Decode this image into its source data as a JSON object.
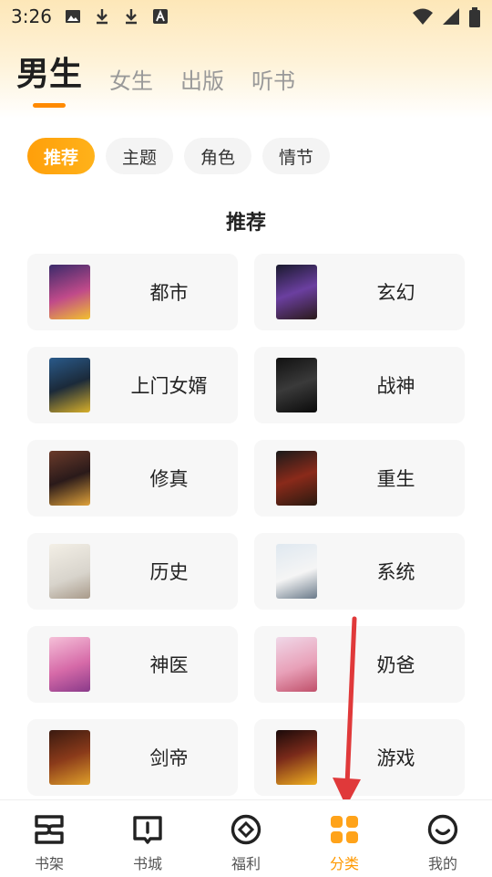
{
  "status": {
    "time": "3:26"
  },
  "tabs": [
    {
      "label": "男生"
    },
    {
      "label": "女生"
    },
    {
      "label": "出版"
    },
    {
      "label": "听书"
    }
  ],
  "chips": [
    {
      "label": "推荐"
    },
    {
      "label": "主题"
    },
    {
      "label": "角色"
    },
    {
      "label": "情节"
    }
  ],
  "section": {
    "title": "推荐"
  },
  "categories": [
    {
      "name": "都市"
    },
    {
      "name": "玄幻"
    },
    {
      "name": "上门女婿"
    },
    {
      "name": "战神"
    },
    {
      "name": "修真"
    },
    {
      "name": "重生"
    },
    {
      "name": "历史"
    },
    {
      "name": "系统"
    },
    {
      "name": "神医"
    },
    {
      "name": "奶爸"
    },
    {
      "name": "剑帝"
    },
    {
      "name": "游戏"
    }
  ],
  "nav": [
    {
      "label": "书架",
      "icon": "bookshelf-icon"
    },
    {
      "label": "书城",
      "icon": "book-icon"
    },
    {
      "label": "福利",
      "icon": "gift-icon"
    },
    {
      "label": "分类",
      "icon": "category-icon"
    },
    {
      "label": "我的",
      "icon": "profile-icon"
    }
  ],
  "colors": {
    "accent": "#ff9900",
    "arrow": "#e53935"
  }
}
